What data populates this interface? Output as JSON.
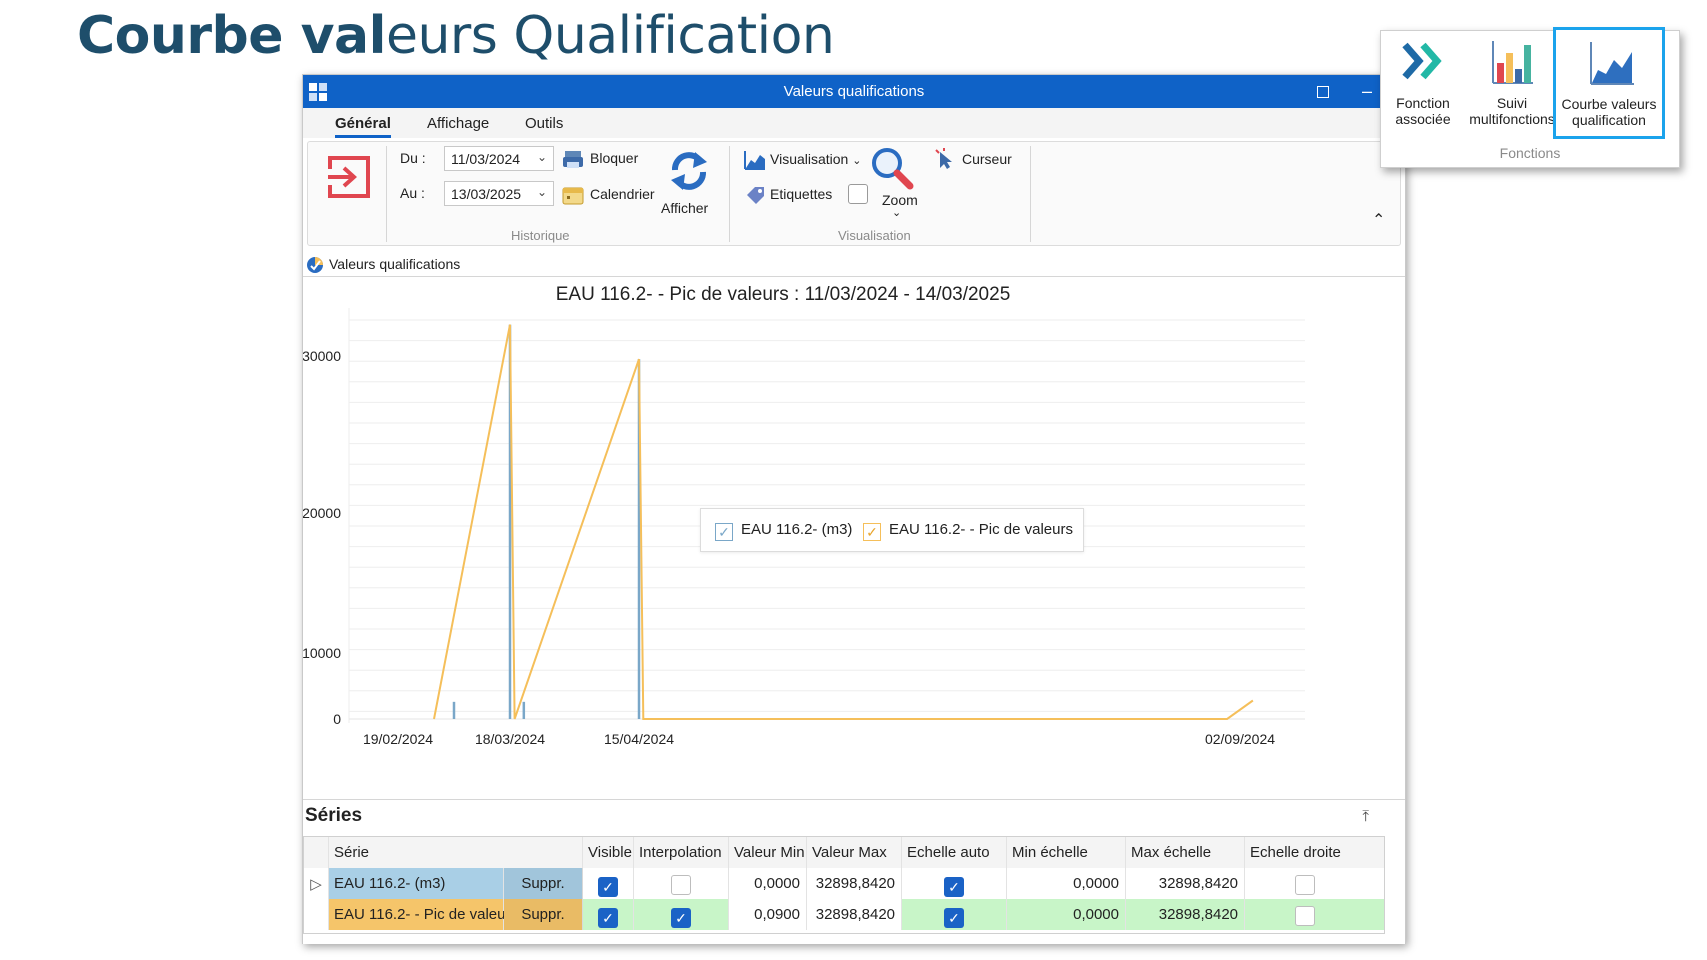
{
  "slide": {
    "title_bold": "Courbe val",
    "title_rest": "eurs Qualification"
  },
  "window": {
    "title": "Valeurs qualifications",
    "minimize_icon": "minimize-icon",
    "maximize_icon": "maximize-icon",
    "close_icon": "close-icon"
  },
  "tabs": [
    {
      "label": "Général",
      "active": true
    },
    {
      "label": "Affichage",
      "active": false
    },
    {
      "label": "Outils",
      "active": false
    }
  ],
  "ribbon": {
    "historique": {
      "du_label": "Du :",
      "du_value": "11/03/2024",
      "au_label": "Au :",
      "au_value": "13/03/2025",
      "bloquer": "Bloquer",
      "calendrier": "Calendrier",
      "afficher": "Afficher",
      "group_label": "Historique"
    },
    "visualisation": {
      "visualisation": "Visualisation",
      "etiquettes": "Etiquettes",
      "zoom": "Zoom",
      "curseur": "Curseur",
      "group_label": "Visualisation"
    }
  },
  "chart_tab_label": "Valeurs qualifications",
  "chart_data": {
    "type": "line",
    "title": "EAU 116.2- - Pic de valeurs : 11/03/2024 - 14/03/2025",
    "ylim": [
      0,
      33000
    ],
    "y_ticks": [
      "30000",
      "20000",
      "10000",
      "0"
    ],
    "x_ticks": [
      "19/02/2024",
      "18/03/2024",
      "15/04/2024",
      "02/09/2024"
    ],
    "grid": true,
    "legend_position": "center",
    "series": [
      {
        "name": "EAU 116.2- (m3)",
        "color": "#7aa7c8",
        "type": "spikes",
        "points": [
          {
            "x": "2024-03-04",
            "y": 2600
          },
          {
            "x": "2024-03-18",
            "y": 32000
          },
          {
            "x": "2024-03-21",
            "y": 2600
          },
          {
            "x": "2024-04-15",
            "y": 29800
          }
        ]
      },
      {
        "name": "EAU 116.2- - Pic de valeurs",
        "color": "#f5bf5a",
        "type": "line",
        "points": [
          {
            "x": "2024-02-28",
            "y": 0
          },
          {
            "x": "2024-03-18",
            "y": 32000
          },
          {
            "x": "2024-03-19",
            "y": 0
          },
          {
            "x": "2024-04-15",
            "y": 29800
          },
          {
            "x": "2024-04-16",
            "y": 0
          },
          {
            "x": "2024-08-30",
            "y": 0
          },
          {
            "x": "2024-09-05",
            "y": 2800
          }
        ]
      }
    ]
  },
  "series_panel": {
    "title": "Séries",
    "pin_icon": "pin-icon",
    "headers": [
      "Série",
      "Visible",
      "Interpolation",
      "Valeur Min",
      "Valeur Max",
      "Echelle auto",
      "Min échelle",
      "Max échelle",
      "Echelle droite"
    ],
    "rows": [
      {
        "serie": "EAU 116.2- (m3)",
        "suppr": "Suppr.",
        "visible": true,
        "interpolation": false,
        "valeur_min": "0,0000",
        "valeur_max": "32898,8420",
        "echelle_auto": true,
        "min_echelle": "0,0000",
        "max_echelle": "32898,8420",
        "echelle_droite": false,
        "color": "#a9cfe6"
      },
      {
        "serie": "EAU 116.2- - Pic de valeurs",
        "suppr": "Suppr.",
        "visible": true,
        "interpolation": true,
        "valeur_min": "0,0900",
        "valeur_max": "32898,8420",
        "echelle_auto": true,
        "min_echelle": "0,0000",
        "max_echelle": "32898,8420",
        "echelle_droite": false,
        "color": "#f5c56a"
      }
    ]
  },
  "popup": {
    "buttons": [
      {
        "label1": "Fonction",
        "label2": "associée",
        "icon": "double-chevron-icon"
      },
      {
        "label1": "Suivi",
        "label2": "multifonctions",
        "icon": "bar-chart-icon"
      },
      {
        "label1": "Courbe valeurs",
        "label2": "qualification",
        "icon": "line-chart-icon"
      }
    ],
    "group_label": "Fonctions"
  }
}
